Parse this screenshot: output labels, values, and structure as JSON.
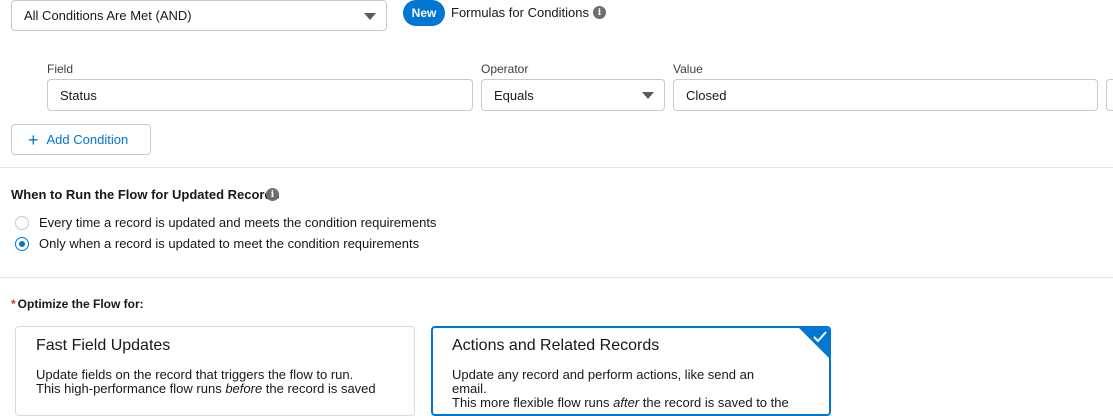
{
  "condition_logic": {
    "selected": "All Conditions Are Met (AND)"
  },
  "formulas": {
    "badge": "New",
    "label": "Formulas for Conditions"
  },
  "condition_row": {
    "field_label": "Field",
    "field_value": "Status",
    "operator_label": "Operator",
    "operator_value": "Equals",
    "value_label": "Value",
    "value_value": "Closed"
  },
  "add_condition": {
    "label": "Add Condition"
  },
  "when_to_run": {
    "title": "When to Run the Flow for Updated Records",
    "options": [
      {
        "label": "Every time a record is updated and meets the condition requirements",
        "checked": false
      },
      {
        "label": "Only when a record is updated to meet the condition requirements",
        "checked": true
      }
    ]
  },
  "optimize": {
    "required_marker": "*",
    "title": "Optimize the Flow for:",
    "cards": [
      {
        "title": "Fast Field Updates",
        "line1": "Update fields on the record that triggers the flow to run.",
        "line2_pre": "This high-performance flow runs ",
        "line2_em": "before",
        "line2_post": " the record is saved",
        "selected": false
      },
      {
        "title": "Actions and Related Records",
        "line1": "Update any record and perform actions, like send an email.",
        "line2_pre": "This more flexible flow runs ",
        "line2_em": "after",
        "line2_post": " the record is saved to the",
        "selected": true
      }
    ]
  },
  "colors": {
    "accent": "#0176d3",
    "border": "#c9c9c9"
  }
}
